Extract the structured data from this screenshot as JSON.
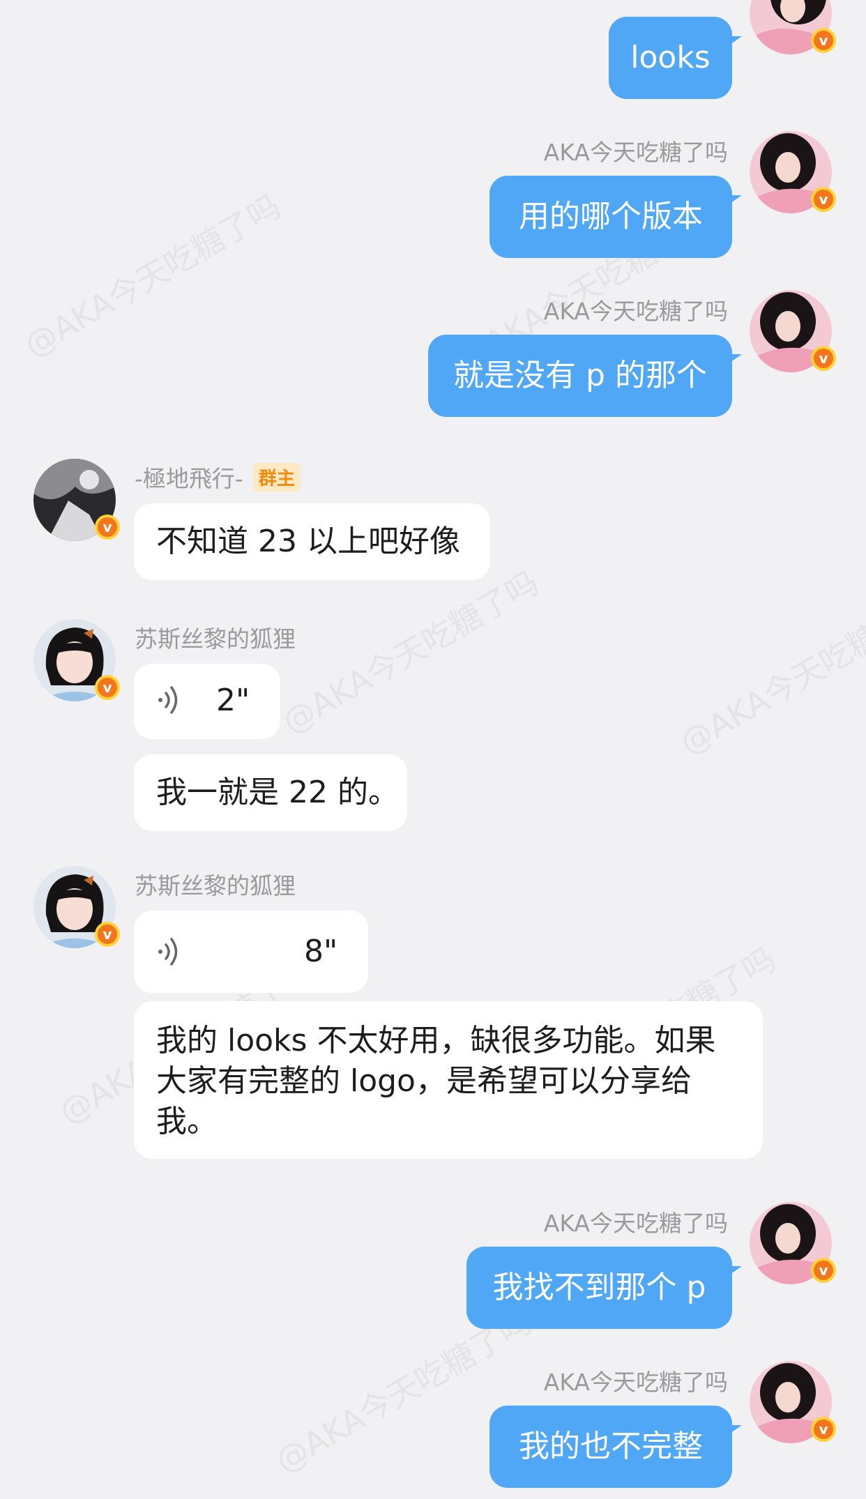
{
  "me": {
    "name": "AKA今天吃糖了吗"
  },
  "messages": [
    {
      "sender": "",
      "text": "looks"
    },
    {
      "sender": "AKA今天吃糖了吗",
      "text": "用的哪个版本"
    },
    {
      "sender": "AKA今天吃糖了吗",
      "text": "就是没有 p 的那个"
    },
    {
      "sender": "-極地飛行-",
      "badge": "群主",
      "text": "不知道 23 以上吧好像"
    },
    {
      "sender": "苏斯丝黎的狐狸",
      "voice_duration": "2\"",
      "text": "我一就是 22 的。"
    },
    {
      "sender": "苏斯丝黎的狐狸",
      "voice_duration": "8\"",
      "text": "我的 looks 不太好用，缺很多功能。如果大家有完整的 logo，是希望可以分享给我。"
    },
    {
      "sender": "AKA今天吃糖了吗",
      "text": "我找不到那个 p"
    },
    {
      "sender": "AKA今天吃糖了吗",
      "text": "我的也不完整"
    }
  ],
  "watermark_text": "@AKA今天吃糖了吗",
  "colors": {
    "background": "#f1f1f3",
    "my_bubble": "#4fa7f5",
    "their_bubble": "#ffffff",
    "v_badge": "#f4761b",
    "owner_badge_text": "#f08b0b"
  }
}
